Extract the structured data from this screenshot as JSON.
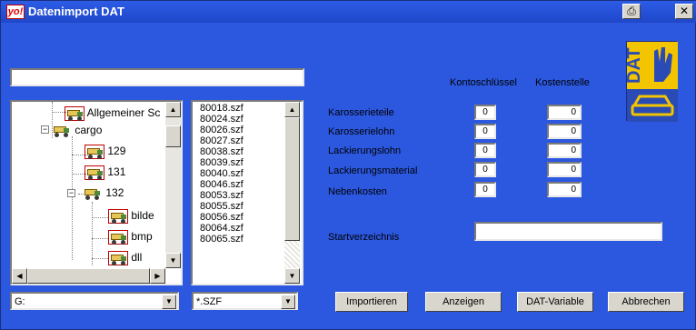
{
  "window": {
    "title": "Datenimport DAT",
    "logo_text": "yo!",
    "buttons": [
      "print-icon",
      "close-icon"
    ],
    "close_glyph": "✕",
    "print_glyph": "⎙"
  },
  "path": {
    "value": ""
  },
  "tree": {
    "items": [
      {
        "label": "Allgemeiner Sc"
      },
      {
        "label": "cargo"
      },
      {
        "label": "129"
      },
      {
        "label": "131"
      },
      {
        "label": "132"
      },
      {
        "label": "bilde"
      },
      {
        "label": "bmp"
      },
      {
        "label": "dll"
      }
    ]
  },
  "files": [
    "80018.szf",
    "80024.szf",
    "80026.szf",
    "80027.szf",
    "80038.szf",
    "80039.szf",
    "80040.szf",
    "80046.szf",
    "80053.szf",
    "80055.szf",
    "80056.szf",
    "80064.szf",
    "80065.szf"
  ],
  "drive": {
    "value": "G:"
  },
  "filter": {
    "value": "*.SZF"
  },
  "accounts": {
    "col_kontoschluessel": "Kontoschlüssel",
    "col_kostenstelle": "Kostenstelle",
    "rows": [
      {
        "label": "Karosserieteile",
        "konto": "0",
        "kosten": "0"
      },
      {
        "label": "Karosserielohn",
        "konto": "0",
        "kosten": "0"
      },
      {
        "label": "Lackierungslohn",
        "konto": "0",
        "kosten": "0"
      },
      {
        "label": "Lackierungsmaterial",
        "konto": "0",
        "kosten": "0"
      },
      {
        "label": "Nebenkosten",
        "konto": "0",
        "kosten": "0"
      }
    ]
  },
  "start": {
    "label": "Startverzeichnis",
    "value": ""
  },
  "actions": {
    "import": "Importieren",
    "show": "Anzeigen",
    "variable": "DAT-Variable",
    "cancel": "Abbrechen"
  },
  "dat_logo": {
    "text": "DAT"
  },
  "colors": {
    "background": "#2c58e0",
    "title_bar": "#1f47c9",
    "logo_yellow": "#f3c400"
  }
}
